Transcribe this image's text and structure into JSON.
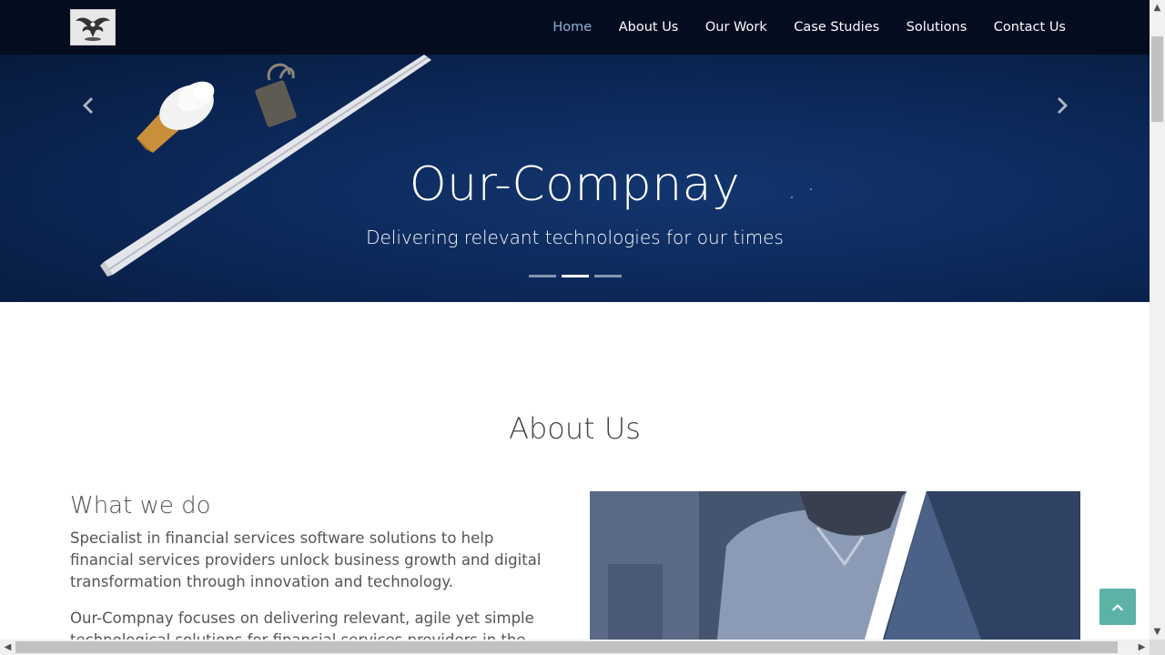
{
  "nav": {
    "items": [
      {
        "label": "Home",
        "active": true
      },
      {
        "label": "About Us"
      },
      {
        "label": "Our Work"
      },
      {
        "label": "Case Studies"
      },
      {
        "label": "Solutions"
      },
      {
        "label": "Contact Us"
      }
    ]
  },
  "hero": {
    "title": "Our-Compnay",
    "subtitle": "Delivering relevant technologies for our times",
    "slides": 3,
    "active_slide": 2
  },
  "about": {
    "title": "About Us",
    "heading": "What we do",
    "paragraphs": [
      "Specialist in financial services software solutions to help financial services providers unlock business growth and digital transformation through innovation and technology.",
      "Our-Compnay focuses on delivering relevant, agile yet simple technological solutions for financial services providers in the emerging"
    ]
  },
  "colors": {
    "navbar": "#040c20",
    "hero_bg": "#0d2a5c",
    "nav_active": "#8fb4d6",
    "back_to_top": "#5cb3a5"
  },
  "icons": [
    "eagle-logo-icon",
    "chevron-left-icon",
    "chevron-right-icon",
    "chevron-up-icon"
  ]
}
